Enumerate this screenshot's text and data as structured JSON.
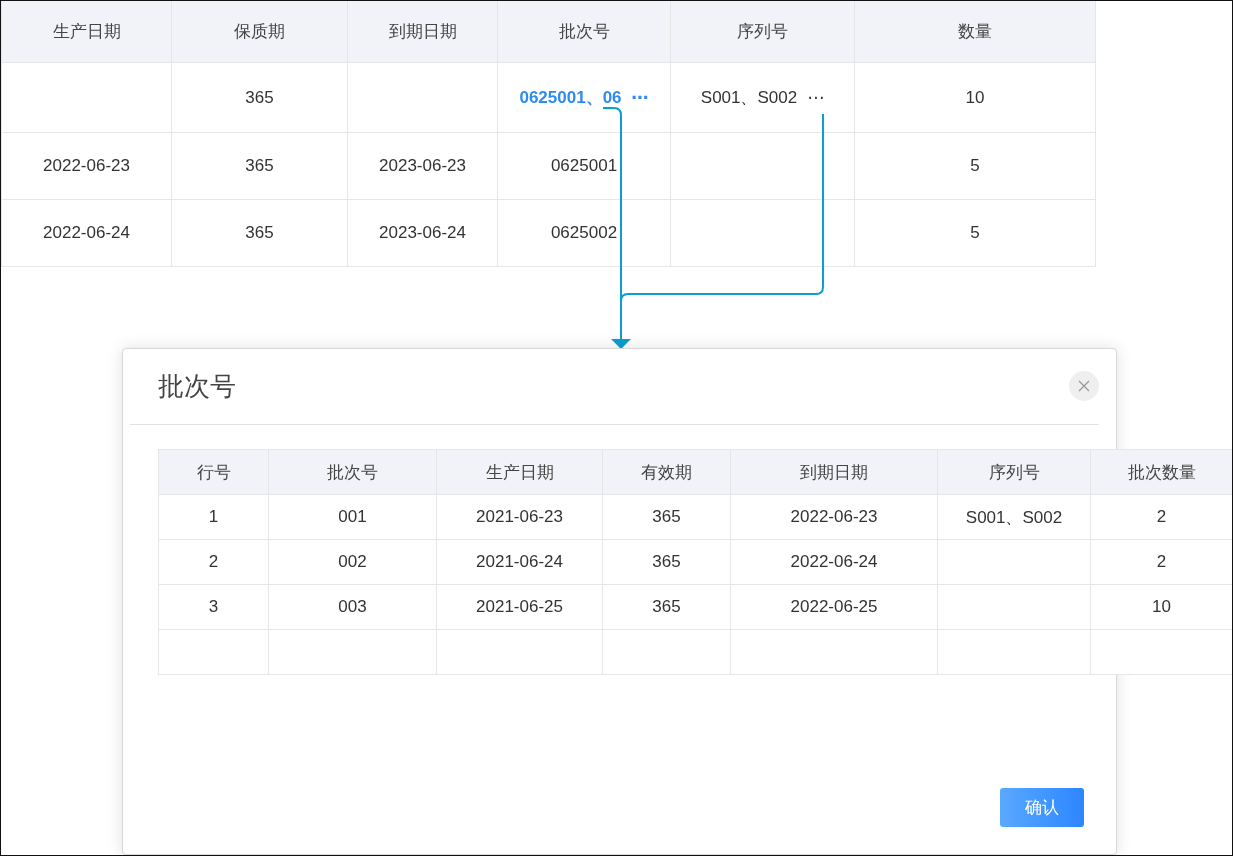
{
  "table": {
    "columns": [
      "生产日期",
      "保质期",
      "到期日期",
      "批次号",
      "序列号",
      "数量"
    ],
    "rows": [
      {
        "cells": [
          {},
          {
            "text": "365"
          },
          {},
          {
            "text": "0625001、06",
            "more": "⋯",
            "kind": "link"
          },
          {
            "text": "S001、S002",
            "more": "⋯",
            "kind": "plain"
          },
          {
            "text": "10"
          }
        ]
      },
      {
        "cells": [
          {
            "text": "2022-06-23"
          },
          {
            "text": "365"
          },
          {
            "text": "2023-06-23"
          },
          {
            "text": "0625001"
          },
          {},
          {
            "text": "5"
          }
        ]
      },
      {
        "cells": [
          {
            "text": "2022-06-24"
          },
          {
            "text": "365"
          },
          {
            "text": "2023-06-24"
          },
          {
            "text": "0625002"
          },
          {},
          {
            "text": "5"
          }
        ]
      }
    ]
  },
  "dialog": {
    "title": "批次号",
    "table": {
      "columns": [
        "行号",
        "批次号",
        "生产日期",
        "有效期",
        "到期日期",
        "序列号",
        "批次数量"
      ],
      "rows": [
        {
          "kind": "data",
          "cells": [
            "1",
            "001",
            "2021-06-23",
            "365",
            "2022-06-23",
            "S001、S002",
            "2"
          ]
        },
        {
          "kind": "data",
          "cells": [
            "2",
            "002",
            "2021-06-24",
            "365",
            "2022-06-24",
            "",
            "2"
          ]
        },
        {
          "kind": "data",
          "cells": [
            "3",
            "003",
            "2021-06-25",
            "365",
            "2022-06-25",
            "",
            "10"
          ]
        },
        {
          "kind": "blank"
        }
      ]
    },
    "confirm_button": "确认"
  }
}
